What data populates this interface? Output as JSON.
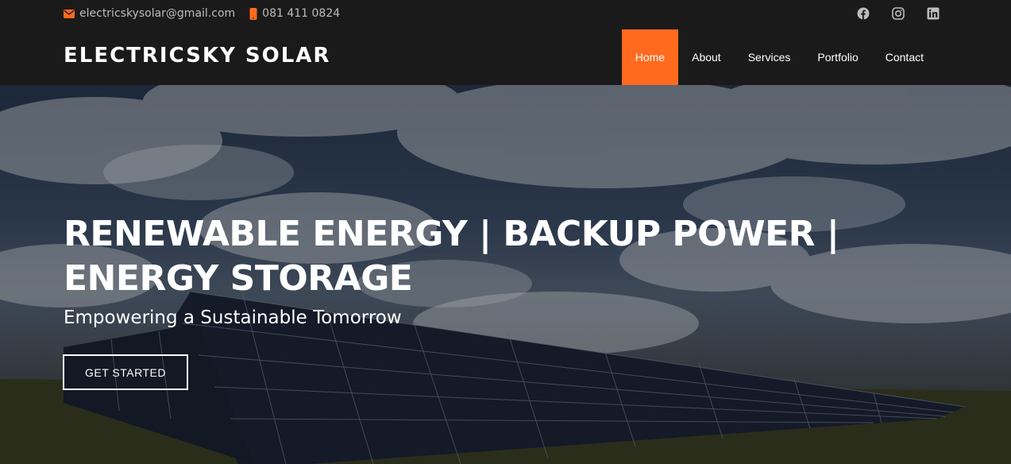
{
  "topbar": {
    "email": "electricskysolar@gmail.com",
    "phone": "081 411 0824",
    "email_icon": "envelope-icon",
    "phone_icon": "mobile-phone-icon",
    "social_icons": [
      "facebook-icon",
      "instagram-icon",
      "linkedin-icon"
    ]
  },
  "header": {
    "brand": "ELECTRICSKY SOLAR",
    "nav": [
      {
        "label": "Home",
        "active": true
      },
      {
        "label": "About",
        "active": false
      },
      {
        "label": "Services",
        "active": false
      },
      {
        "label": "Portfolio",
        "active": false
      },
      {
        "label": "Contact",
        "active": false
      }
    ]
  },
  "hero": {
    "title": "RENEWABLE ENERGY | BACKUP POWER | ENERGY STORAGE",
    "subtitle": "Empowering a Sustainable Tomorrow",
    "cta_label": "GET STARTED"
  },
  "colors": {
    "accent": "#ff6a1f",
    "bar_background": "#1a1a1a",
    "text_muted": "#bdbdbd"
  }
}
